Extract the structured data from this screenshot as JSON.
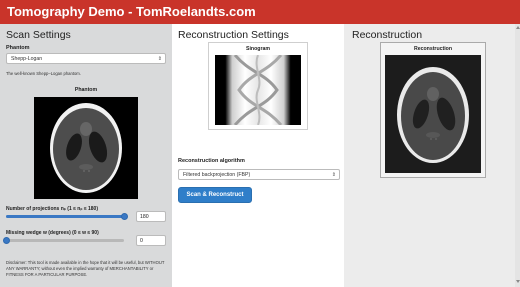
{
  "app": {
    "title": "Tomography Demo - TomRoelandts.com"
  },
  "scan_settings": {
    "heading": "Scan Settings",
    "phantom_label": "Phantom",
    "phantom_selected": "Shepp-Logan",
    "phantom_caret": "⇕",
    "phantom_description": "The well-known Shepp–Logan phantom.",
    "phantom_figure_title": "Phantom",
    "projections_label": "Number of projections nₚ (1 ≤ nₚ ≤ 180)",
    "projections_value": "180",
    "projections_fraction": 1.0,
    "wedge_label": "Missing wedge w (degrees) (0 ≤ w ≤ 90)",
    "wedge_value": "0",
    "wedge_fraction": 0.0,
    "disclaimer": "Disclaimer: This tool is made available in the hope that it will be useful, but WITHOUT ANY WARRANTY; without even the implied warranty of MERCHANTABILITY or FITNESS FOR A PARTICULAR PURPOSE."
  },
  "reconstruction_settings": {
    "heading": "Reconstruction Settings",
    "sinogram_title": "Sinogram",
    "algorithm_label": "Reconstruction algorithm",
    "algorithm_selected": "Filtered backprojection (FBP)",
    "algorithm_caret": "⇕",
    "button_label": "Scan & Reconstruct"
  },
  "reconstruction": {
    "heading": "Reconstruction",
    "figure_title": "Reconstruction"
  },
  "colors": {
    "topbar": "#c9342a",
    "accent": "#2f7ec9",
    "left_panel": "#d9dadb",
    "right_panel": "#ececec"
  }
}
